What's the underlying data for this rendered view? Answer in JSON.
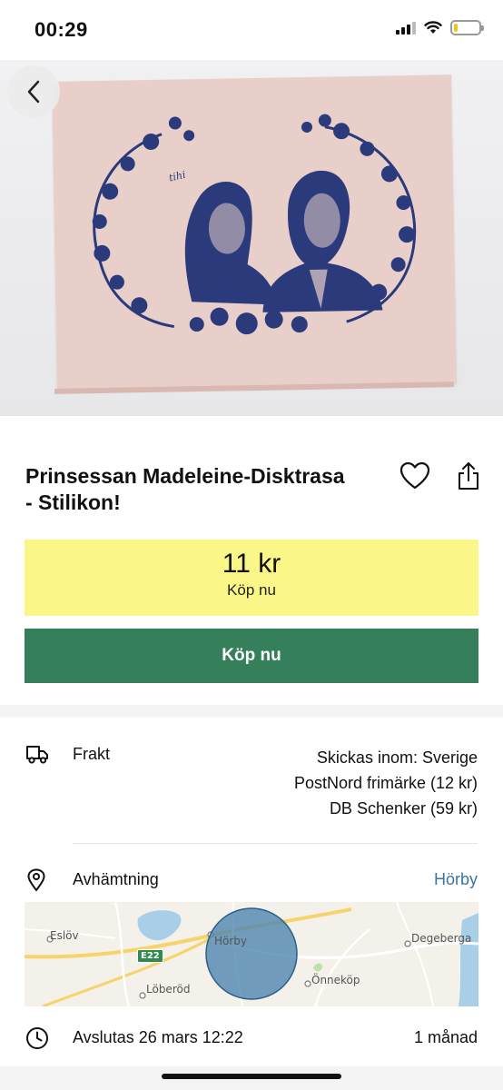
{
  "status_bar": {
    "time": "00:29",
    "battery_level": 0.15,
    "battery_color": "#f2c418"
  },
  "hero": {
    "image_description_icon": "product-photo",
    "cloth_text": "tihi"
  },
  "product": {
    "title": "Prinsessan Madeleine-Disktrasa - Stilikon!",
    "price": "11 kr",
    "price_label": "Köp nu",
    "buy_button_label": "Köp nu",
    "accent_color": "#357f5a",
    "price_bg_color": "#fbf688"
  },
  "shipping": {
    "label": "Frakt",
    "lines": [
      "Skickas inom: Sverige",
      "PostNord frimärke (12 kr)",
      "DB Schenker (59 kr)"
    ]
  },
  "pickup": {
    "label": "Avhämtning",
    "city": "Hörby",
    "link_color": "#3a74a3"
  },
  "map": {
    "labels": {
      "eslov": "Eslöv",
      "horby": "Hörby",
      "degeberga": "Degeberga",
      "loberod": "Löberöd",
      "onnekop": "Önneköp",
      "road": "E22"
    }
  },
  "end": {
    "label": "Avslutas 26 mars 12:22",
    "remaining": "1 månad"
  }
}
